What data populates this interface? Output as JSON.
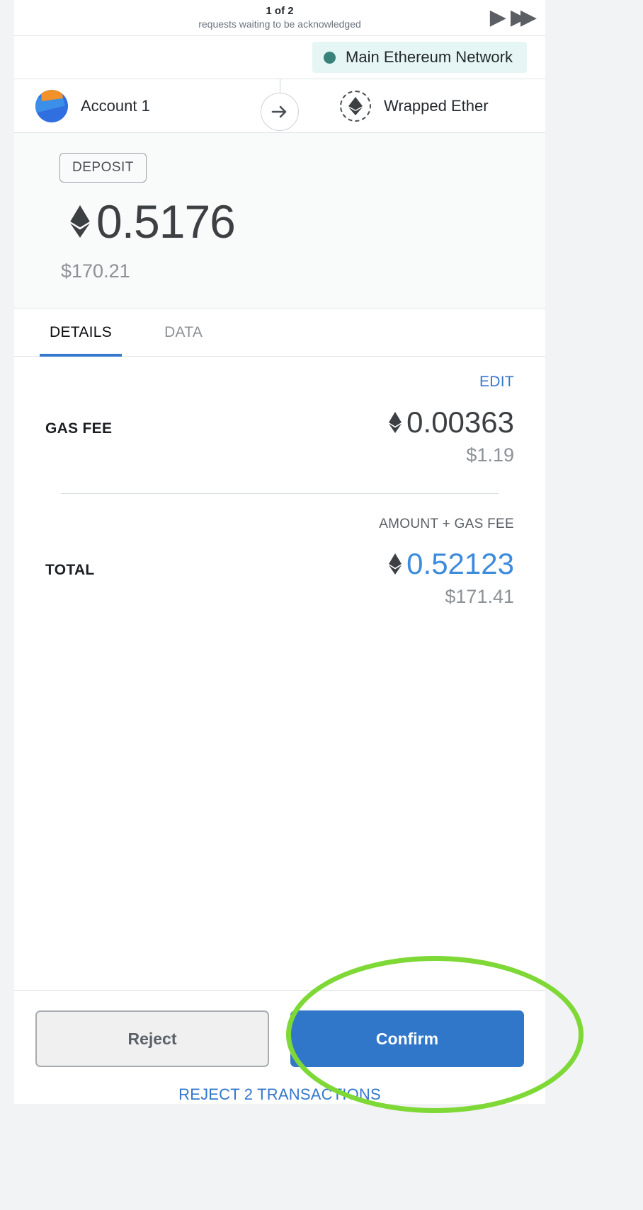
{
  "pending": {
    "count_label": "1 of 2",
    "subtitle": "requests waiting to be acknowledged",
    "next_icon": "▶",
    "last_icon": "▶▶"
  },
  "network": {
    "name": "Main Ethereum Network",
    "dot_color": "#37837c",
    "pill_background": "#e5f6f4"
  },
  "parties": {
    "sender_name": "Account 1",
    "recipient_name": "Wrapped Ether",
    "arrow_icon": "→",
    "eth_icon": "♦"
  },
  "amount": {
    "type_badge": "DEPOSIT",
    "crypto_symbol": "♦",
    "crypto_value": "0.5176",
    "fiat_value": "$170.21"
  },
  "tabs": [
    {
      "label": "DETAILS",
      "active": true
    },
    {
      "label": "DATA",
      "active": false
    }
  ],
  "details": {
    "edit_label": "EDIT",
    "gas_fee": {
      "label": "GAS FEE",
      "crypto_symbol": "♦",
      "crypto_value": "0.00363",
      "fiat_value": "$1.19"
    },
    "total": {
      "sub_label": "AMOUNT + GAS FEE",
      "label": "TOTAL",
      "crypto_symbol": "♦",
      "crypto_value": "0.52123",
      "fiat_value": "$171.41",
      "value_color": "#3d8bdd"
    }
  },
  "footer": {
    "reject_label": "Reject",
    "confirm_label": "Confirm",
    "reject_all_label": "REJECT 2 TRANSACTIONS"
  },
  "annotation": {
    "shape": "ellipse",
    "color": "#7ed836",
    "target": "confirm-button"
  }
}
